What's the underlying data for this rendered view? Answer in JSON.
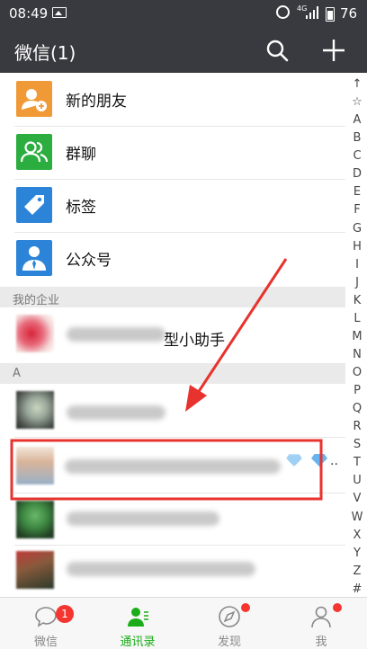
{
  "status_bar": {
    "time": "08:49",
    "network": "4G",
    "battery": "76"
  },
  "header": {
    "title": "微信(1)",
    "search_icon": "search-icon",
    "add_icon": "plus-icon"
  },
  "menu_items": [
    {
      "label": "新的朋友",
      "icon": "add-friend-icon",
      "color": "#f09a37"
    },
    {
      "label": "群聊",
      "icon": "group-chat-icon",
      "color": "#2bad3f"
    },
    {
      "label": "标签",
      "icon": "tag-icon",
      "color": "#2c84d9"
    },
    {
      "label": "公众号",
      "icon": "official-account-icon",
      "color": "#2c84d9"
    }
  ],
  "sections": {
    "enterprise": "我的企业",
    "a": "A"
  },
  "enterprise_item": {
    "label_visible": "型小助手"
  },
  "index_letters": [
    "↑",
    "☆",
    "A",
    "B",
    "C",
    "D",
    "E",
    "F",
    "G",
    "H",
    "I",
    "J",
    "K",
    "L",
    "M",
    "N",
    "O",
    "P",
    "Q",
    "R",
    "S",
    "T",
    "U",
    "V",
    "W",
    "X",
    "Y",
    "Z",
    "#"
  ],
  "tabs": [
    {
      "label": "微信",
      "icon": "chat-bubble-icon",
      "badge": "1"
    },
    {
      "label": "通讯录",
      "icon": "contacts-icon",
      "active": true
    },
    {
      "label": "发现",
      "icon": "compass-icon",
      "dot": true
    },
    {
      "label": "我",
      "icon": "person-icon",
      "dot": true
    }
  ],
  "colors": {
    "header_bg": "#393a3f",
    "active_tab": "#1aad19",
    "badge": "#f43530",
    "annotation": "#e8322e"
  }
}
